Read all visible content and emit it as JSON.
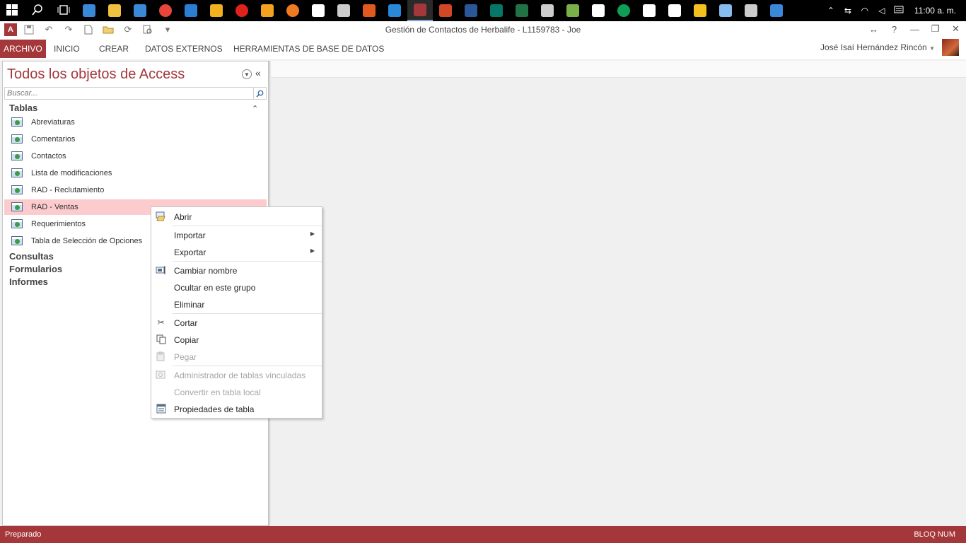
{
  "taskbar": {
    "icons": [
      {
        "name": "start-icon",
        "color": "#ffffff"
      },
      {
        "name": "search-icon",
        "color": "#ffffff"
      },
      {
        "name": "task-view-icon",
        "color": "#ffffff"
      },
      {
        "name": "this-pc-icon",
        "color": "#3a88d8"
      },
      {
        "name": "file-explorer-icon",
        "color": "#f0c040"
      },
      {
        "name": "onedrive-icon",
        "color": "#3a88d8"
      },
      {
        "name": "chrome-icon",
        "color": "#e8453c"
      },
      {
        "name": "edge-icon",
        "color": "#2a7fd4"
      },
      {
        "name": "internet-explorer-icon",
        "color": "#f0b020"
      },
      {
        "name": "opera-icon",
        "color": "#e0221c"
      },
      {
        "name": "photos-icon",
        "color": "#f4a020"
      },
      {
        "name": "firefox-icon",
        "color": "#f07a20"
      },
      {
        "name": "store-icon",
        "color": "#ffffff"
      },
      {
        "name": "media-icon",
        "color": "#cccccc"
      },
      {
        "name": "app-orange-icon",
        "color": "#e05a20"
      },
      {
        "name": "app-blue-icon",
        "color": "#2a88d8"
      },
      {
        "name": "access-icon",
        "color": "#a4373a",
        "active": true
      },
      {
        "name": "powerpoint-icon",
        "color": "#d24726"
      },
      {
        "name": "word-icon",
        "color": "#2b579a"
      },
      {
        "name": "publisher-icon",
        "color": "#077568"
      },
      {
        "name": "excel-icon",
        "color": "#217346"
      },
      {
        "name": "calculator-icon",
        "color": "#cccccc"
      },
      {
        "name": "app-people-icon",
        "color": "#7ab04a"
      },
      {
        "name": "mail-icon",
        "color": "#ffffff"
      },
      {
        "name": "hangouts-icon",
        "color": "#0f9d58"
      },
      {
        "name": "alarm-icon",
        "color": "#ffffff"
      },
      {
        "name": "flag-icon",
        "color": "#ffffff"
      },
      {
        "name": "keep-icon",
        "color": "#f4c020"
      },
      {
        "name": "notepad-icon",
        "color": "#88bbee"
      },
      {
        "name": "camera-icon",
        "color": "#cccccc"
      },
      {
        "name": "app-cloud-icon",
        "color": "#3a88d8"
      }
    ],
    "tray": [
      "chevron-up-icon",
      "network-off-icon",
      "wifi-icon",
      "volume-icon"
    ],
    "time": "11:00 a. m."
  },
  "window": {
    "title": "Gestión de Contactos de Herbalife - L1159783 - Joe",
    "help": "?",
    "minimize": "—",
    "restore": "❐",
    "close": "✕"
  },
  "ribbon": {
    "tabs": [
      "ARCHIVO",
      "INICIO",
      "CREAR",
      "DATOS EXTERNOS",
      "HERRAMIENTAS DE BASE DE DATOS"
    ],
    "user": "José Isaí Hernández Rincón"
  },
  "nav": {
    "title": "Todos los objetos de Access",
    "search_placeholder": "Buscar...",
    "group_tables": "Tablas",
    "tables": [
      "Abreviaturas",
      "Comentarios",
      "Contactos",
      "Lista de modificaciones",
      "RAD - Reclutamiento",
      "RAD - Ventas",
      "Requerimientos",
      "Tabla de Selección de Opciones"
    ],
    "selected_table": "RAD - Ventas",
    "groups": [
      "Consultas",
      "Formularios",
      "Informes"
    ]
  },
  "context_menu": {
    "items": [
      {
        "label": "Abrir",
        "icon": "open-icon",
        "enabled": true
      },
      {
        "label": "Importar",
        "submenu": true,
        "enabled": true
      },
      {
        "label": "Exportar",
        "submenu": true,
        "enabled": true
      },
      {
        "label": "Cambiar nombre",
        "icon": "rename-icon",
        "enabled": true
      },
      {
        "label": "Ocultar en este grupo",
        "enabled": true
      },
      {
        "label": "Eliminar",
        "enabled": true
      },
      {
        "label": "Cortar",
        "icon": "scissors-icon",
        "enabled": true
      },
      {
        "label": "Copiar",
        "icon": "copy-icon",
        "enabled": true
      },
      {
        "label": "Pegar",
        "icon": "paste-icon",
        "enabled": false
      },
      {
        "label": "Administrador de tablas vinculadas",
        "icon": "linked-tables-icon",
        "enabled": false
      },
      {
        "label": "Convertir en tabla local",
        "enabled": false
      },
      {
        "label": "Propiedades de tabla",
        "icon": "properties-icon",
        "enabled": true
      }
    ]
  },
  "status": {
    "left": "Preparado",
    "right": "BLOQ NUM"
  },
  "colors": {
    "accent": "#a4373a",
    "selection": "#fccbcd"
  }
}
